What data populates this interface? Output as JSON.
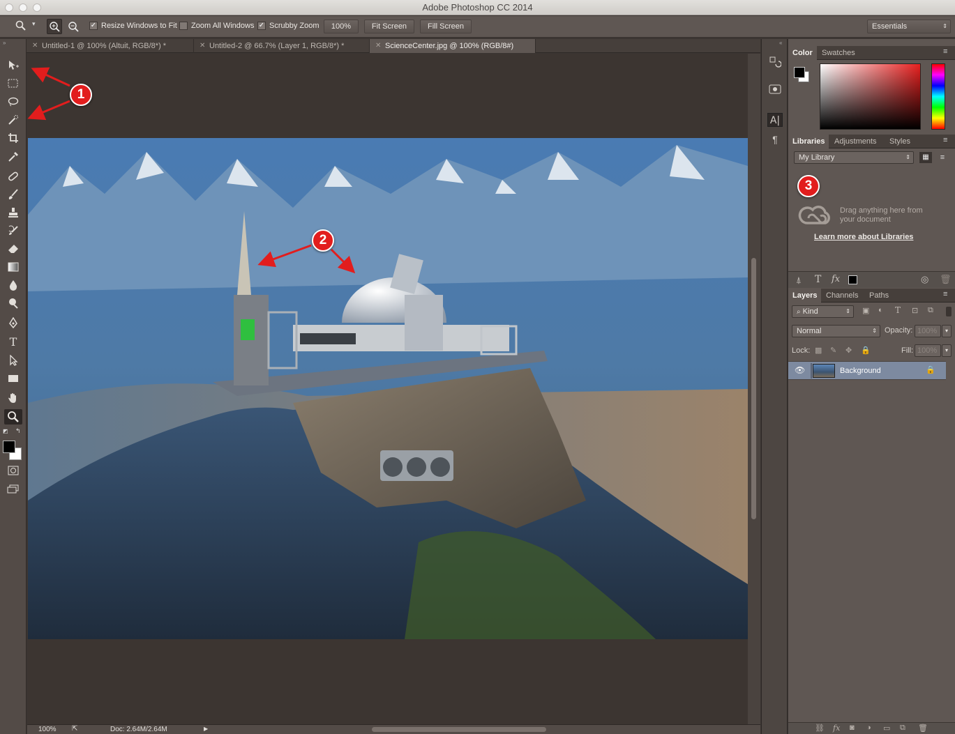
{
  "window": {
    "title": "Adobe Photoshop CC 2014"
  },
  "options": {
    "resize_label": "Resize Windows to Fit",
    "zoom_all_label": "Zoom All Windows",
    "scrubby_label": "Scrubby Zoom",
    "zoom_value": "100%",
    "fit_screen": "Fit Screen",
    "fill_screen": "Fill Screen",
    "workspace": "Essentials",
    "resize_checked": true,
    "zoom_all_checked": false,
    "scrubby_checked": true
  },
  "tabs": [
    {
      "label": "Untitled-1 @ 100% (Altuit, RGB/8*) *"
    },
    {
      "label": "Untitled-2 @ 66.7% (Layer 1, RGB/8*) *"
    },
    {
      "label": "ScienceCenter.jpg @ 100% (RGB/8#)"
    }
  ],
  "tools": [
    "move-tool-icon",
    "marquee-tool-icon",
    "lasso-tool-icon",
    "quick-selection-tool-icon",
    "crop-tool-icon",
    "eyedropper-tool-icon",
    "healing-brush-icon",
    "brush-tool-icon",
    "clone-stamp-icon",
    "history-brush-icon",
    "eraser-tool-icon",
    "gradient-tool-icon",
    "blur-tool-icon",
    "dodge-tool-icon",
    "pen-tool-icon",
    "type-tool-icon",
    "path-selection-icon",
    "rectangle-tool-icon",
    "hand-tool-icon",
    "zoom-tool-icon"
  ],
  "status": {
    "zoom": "100%",
    "doc": "Doc: 2.64M/2.64M"
  },
  "color_panel": {
    "tabs": [
      "Color",
      "Swatches"
    ],
    "fg": "#000000",
    "bg": "#ffffff",
    "hue": "#e8201f"
  },
  "libraries_panel": {
    "tabs": [
      "Libraries",
      "Adjustments",
      "Styles"
    ],
    "library_select": "My Library",
    "drag_text_1": "Drag anything here from",
    "drag_text_2": "your document",
    "learn_link": "Learn more about Libraries"
  },
  "layers_panel": {
    "tabs": [
      "Layers",
      "Channels",
      "Paths"
    ],
    "filter_kind": "Kind",
    "blend_mode": "Normal",
    "opacity_label": "Opacity:",
    "opacity_value": "100%",
    "lock_label": "Lock:",
    "fill_label": "Fill:",
    "fill_value": "100%",
    "layers": [
      {
        "name": "Background",
        "visible": true,
        "locked": true
      }
    ]
  },
  "annotations": [
    "1",
    "2",
    "3"
  ],
  "colors": {
    "accent_red": "#e21d1d",
    "panel": "#5f5753",
    "canvas_bg": "#3c3531",
    "selected_layer": "#7d8aa0"
  }
}
